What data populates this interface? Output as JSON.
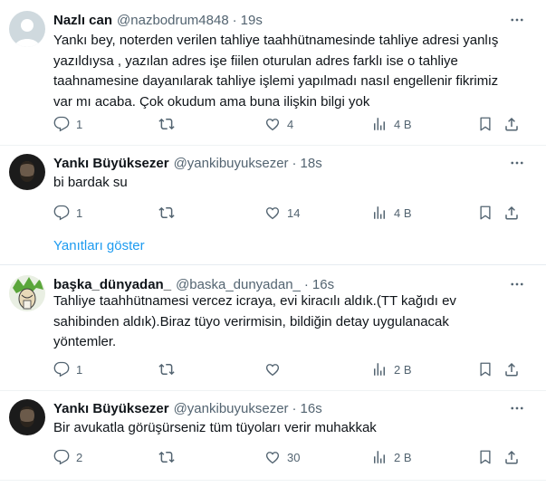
{
  "tweets": [
    {
      "name": "Nazlı can",
      "handle": "@nazbodrum4848",
      "time": "19s",
      "text": "Yankı bey, noterden verilen tahliye taahhütnamesinde tahliye adresi yanlış\nyazıldıysa , yazılan adres işe fiilen oturulan adres farklı ise o tahliye\ntaahnamesine dayanılarak tahliye işlemi yapılmadı nasıl engellenir fikrimiz\nvar mı acaba. Çok okudum ama buna ilişkin bilgi yok",
      "replies": "1",
      "retweets": "",
      "likes": "4",
      "views": "4 B",
      "avatar_color": "#cfd9de"
    },
    {
      "name": "Yankı Büyüksezer",
      "handle": "@yankibuyuksezer",
      "time": "18s",
      "text": "bi bardak su",
      "replies": "1",
      "retweets": "",
      "likes": "14",
      "views": "4 B",
      "avatar_color": "#1b1b1b"
    },
    {
      "name": "başka_dünyadan_",
      "handle": "@baska_dunyadan_",
      "time": "16s",
      "text": "Tahliye taahhütnamesi vercez icraya, evi kiracılı aldık.(TT kağıdı ev\nsahibinden aldık).Biraz tüyo verirmisin, bildiğin detay uygulanacak\nyöntemler.",
      "replies": "1",
      "retweets": "",
      "likes": "",
      "views": "2 B",
      "avatar_color": "#6fbf3f"
    },
    {
      "name": "Yankı Büyüksezer",
      "handle": "@yankibuyuksezer",
      "time": "16s",
      "text": "Bir avukatla görüşürseniz tüm tüyoları verir muhakkak",
      "replies": "2",
      "retweets": "",
      "likes": "30",
      "views": "2 B",
      "avatar_color": "#1b1b1b"
    }
  ],
  "show_replies_label": "Yanıtları göster",
  "colors": {
    "link": "#1d9bf0",
    "secondary": "#536471",
    "thread_line": "#cfd9de"
  }
}
